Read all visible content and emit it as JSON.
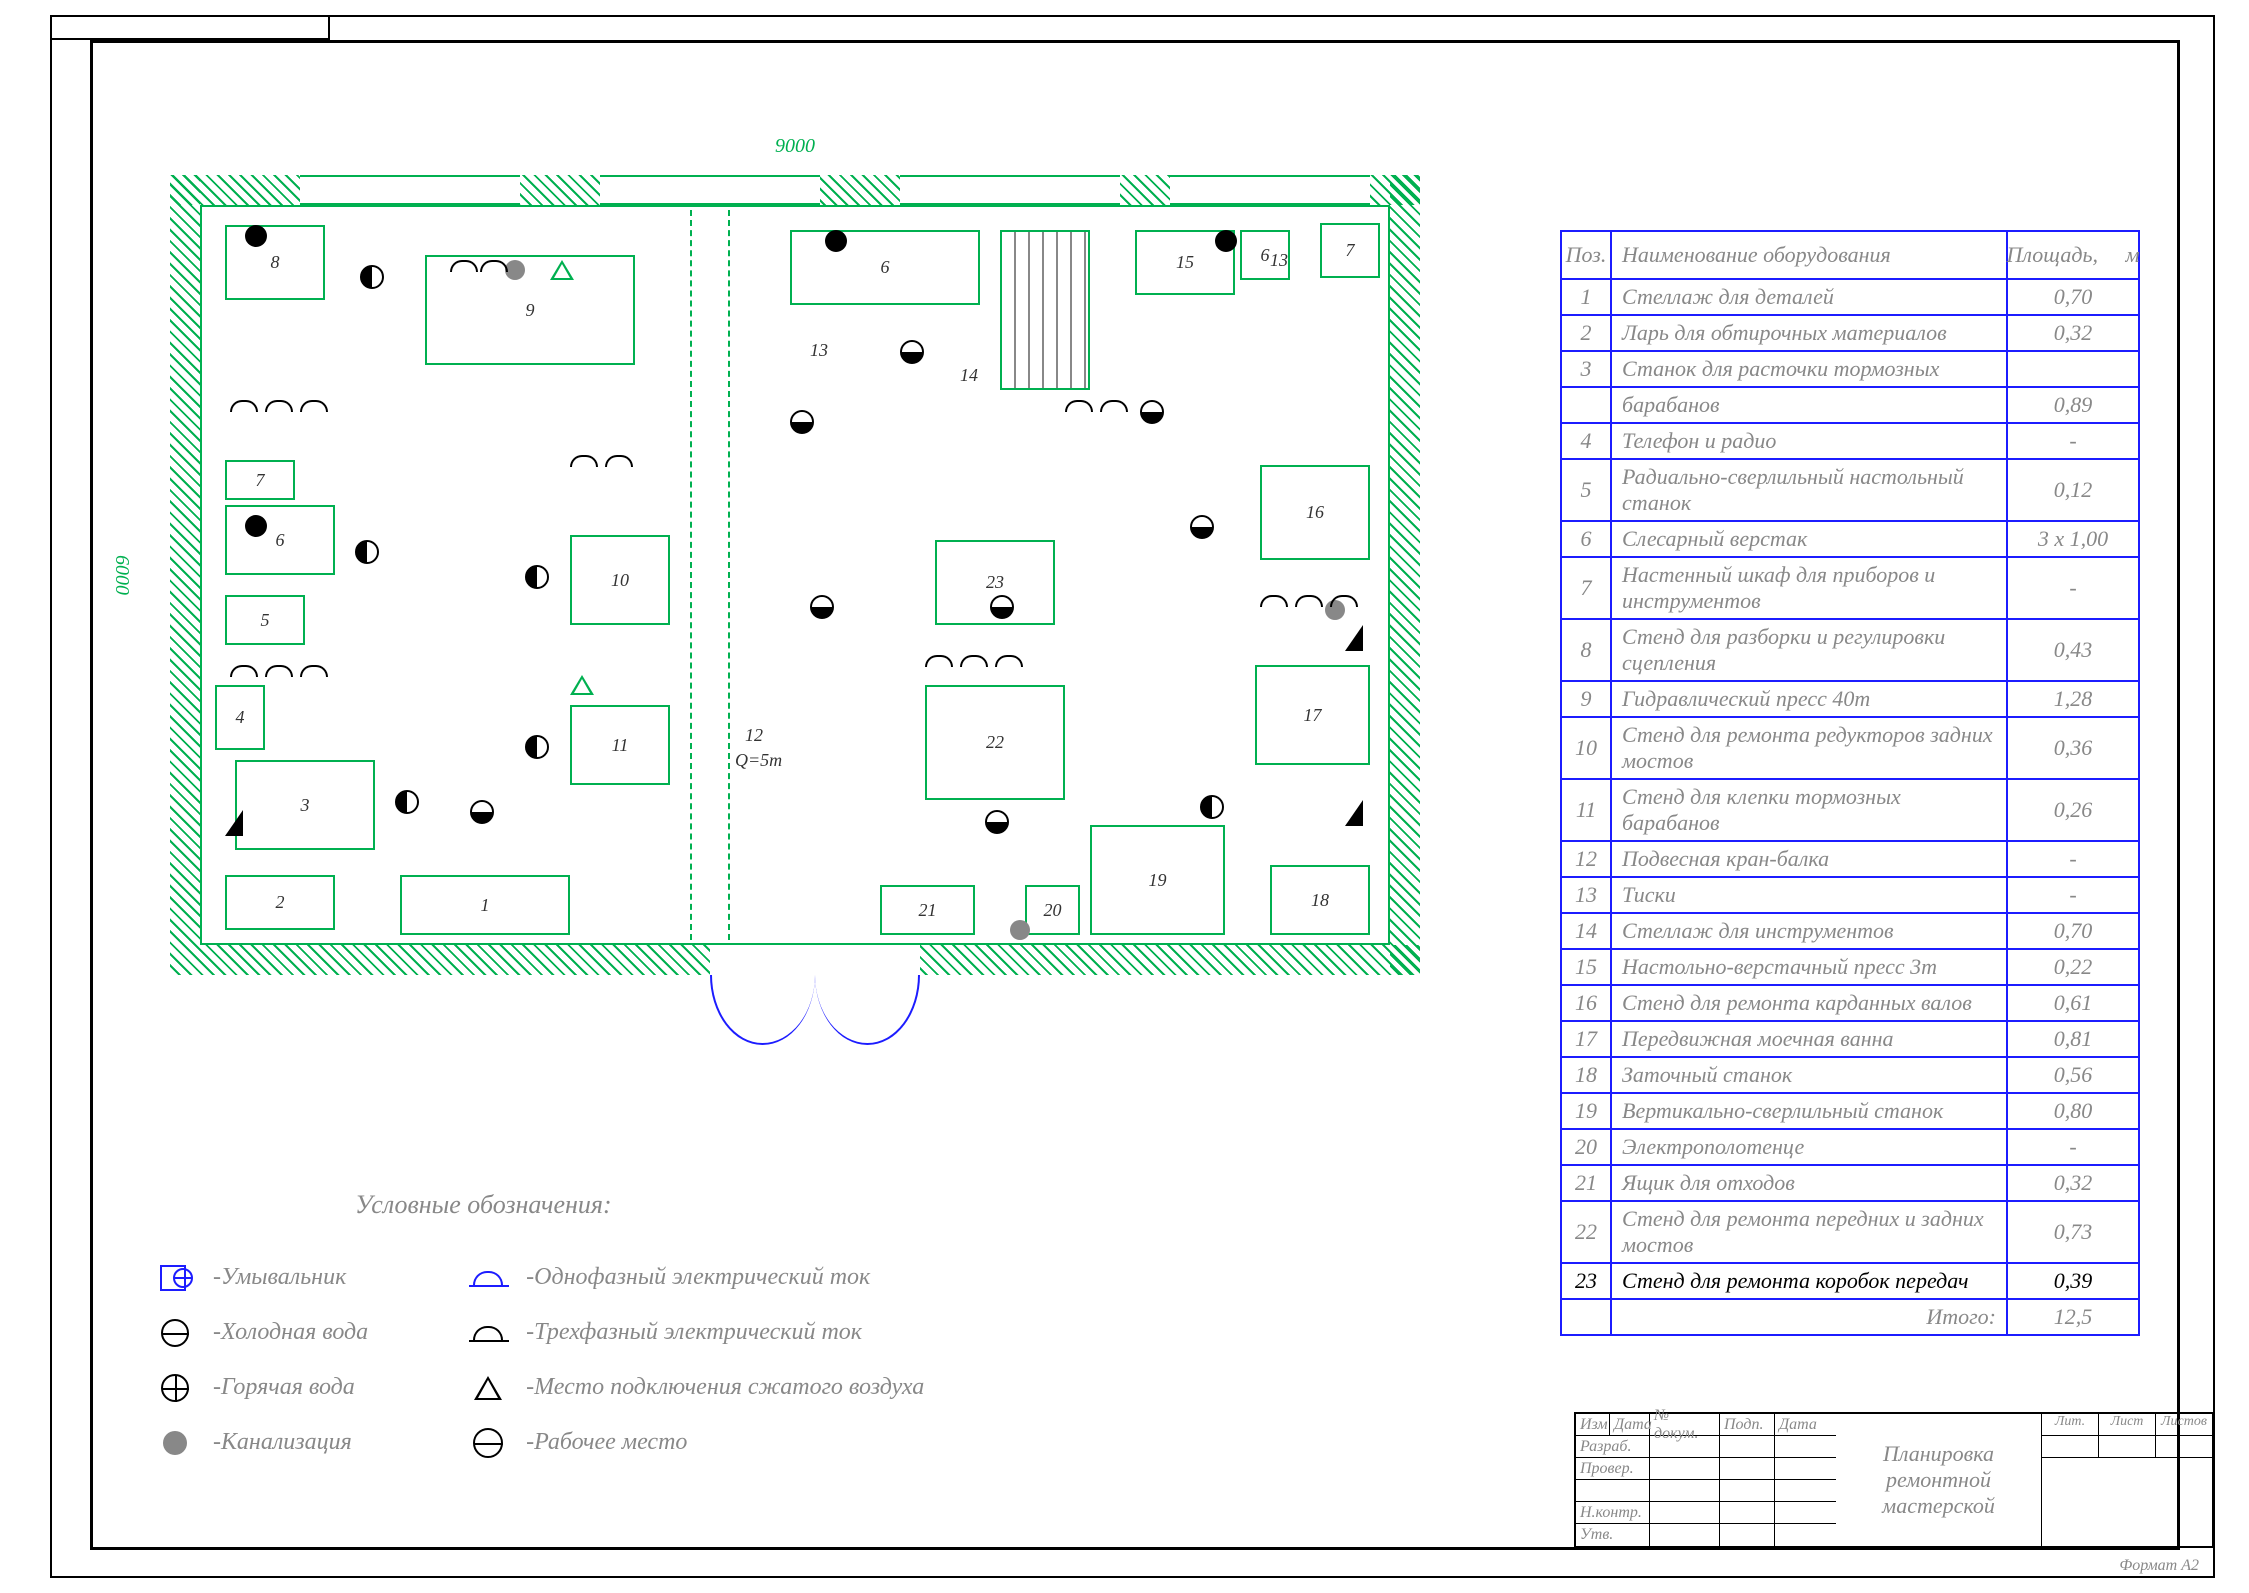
{
  "dimensions": {
    "width": "9000",
    "height": "6000",
    "doorWidth": "1500"
  },
  "crane": {
    "label": "12",
    "sub": "Q=5т"
  },
  "equipment_on_plan": [
    {
      "n": "1"
    },
    {
      "n": "2"
    },
    {
      "n": "3"
    },
    {
      "n": "4"
    },
    {
      "n": "5"
    },
    {
      "n": "6"
    },
    {
      "n": "7"
    },
    {
      "n": "8"
    },
    {
      "n": "9"
    },
    {
      "n": "10"
    },
    {
      "n": "11"
    },
    {
      "n": "13"
    },
    {
      "n": "14"
    },
    {
      "n": "15"
    },
    {
      "n": "16"
    },
    {
      "n": "17"
    },
    {
      "n": "18"
    },
    {
      "n": "19"
    },
    {
      "n": "20"
    },
    {
      "n": "21"
    },
    {
      "n": "22"
    },
    {
      "n": "23"
    }
  ],
  "table": {
    "headers": {
      "pos": "Поз.",
      "name": "Наименование оборудования",
      "area": "Площадь,",
      "unit": "м"
    },
    "rows": [
      {
        "pos": "1",
        "name": "Стеллаж для деталей",
        "area": "0,70"
      },
      {
        "pos": "2",
        "name": "Ларь для обтирочных материалов",
        "area": "0,32"
      },
      {
        "pos": "3",
        "name": "Станок для расточки тормозных",
        "area": ""
      },
      {
        "pos": "",
        "name": "барабанов",
        "area": "0,89"
      },
      {
        "pos": "4",
        "name": "Телефон и радио",
        "area": "-"
      },
      {
        "pos": "5",
        "name": "Радиально-сверлильный настольный станок",
        "area": "0,12"
      },
      {
        "pos": "6",
        "name": "Слесарный верстак",
        "area": "3 х 1,00"
      },
      {
        "pos": "7",
        "name": "Настенный шкаф для приборов и инструментов",
        "area": "-"
      },
      {
        "pos": "8",
        "name": "Стенд для разборки и регулировки сцепления",
        "area": "0,43"
      },
      {
        "pos": "9",
        "name": "Гидравлический пресс 40т",
        "area": "1,28"
      },
      {
        "pos": "10",
        "name": "Стенд для ремонта редукторов задних мостов",
        "area": "0,36"
      },
      {
        "pos": "11",
        "name": "Стенд для клепки тормозных барабанов",
        "area": "0,26"
      },
      {
        "pos": "12",
        "name": "Подвесная кран-балка",
        "area": "-"
      },
      {
        "pos": "13",
        "name": "Тиски",
        "area": "-"
      },
      {
        "pos": "14",
        "name": "Стеллаж для инструментов",
        "area": "0,70"
      },
      {
        "pos": "15",
        "name": "Настольно-верстачный пресс 3т",
        "area": "0,22"
      },
      {
        "pos": "16",
        "name": "Стенд для ремонта карданных валов",
        "area": "0,61"
      },
      {
        "pos": "17",
        "name": "Передвижная моечная ванна",
        "area": "0,81"
      },
      {
        "pos": "18",
        "name": "Заточный станок",
        "area": "0,56"
      },
      {
        "pos": "19",
        "name": "Вертикально-сверлильный станок",
        "area": "0,80"
      },
      {
        "pos": "20",
        "name": "Электрополотенце",
        "area": "-"
      },
      {
        "pos": "21",
        "name": "Ящик для отходов",
        "area": "0,32"
      },
      {
        "pos": "22",
        "name": "Стенд для ремонта передних и задних мостов",
        "area": "0,73"
      },
      {
        "pos": "23",
        "name": "Стенд для ремонта коробок передач",
        "area": "0,39",
        "active": true
      }
    ],
    "total": {
      "label": "Итого:",
      "value": "12,5"
    }
  },
  "legend": {
    "title": "Условные обозначения:",
    "left": [
      {
        "key": "sink",
        "label": "-Умывальник"
      },
      {
        "key": "cold",
        "label": "-Холодная вода"
      },
      {
        "key": "hot",
        "label": "-Горячая вода"
      },
      {
        "key": "sewer",
        "label": "-Канализация"
      }
    ],
    "right": [
      {
        "key": "ph1",
        "label": "-Однофазный электрический ток"
      },
      {
        "key": "ph3",
        "label": "-Трехфазный электрический ток"
      },
      {
        "key": "air",
        "label": "-Место подключения сжатого воздуха"
      },
      {
        "key": "work",
        "label": "-Рабочее место"
      }
    ]
  },
  "titleblock": {
    "cells": {
      "izm": "Изм",
      "data": "Дата",
      "doc": "№ докум.",
      "sign": "Подп.",
      "date2": "Дата",
      "razrab": "Разраб.",
      "prover": "Провер.",
      "nkontr": "Н.контр.",
      "utv": "Утв.",
      "title1": "Планировка",
      "title2": "ремонтной мастерской",
      "lit": "Лит.",
      "list": "Лист",
      "listov": "Листов"
    },
    "format": "Формат А2"
  }
}
